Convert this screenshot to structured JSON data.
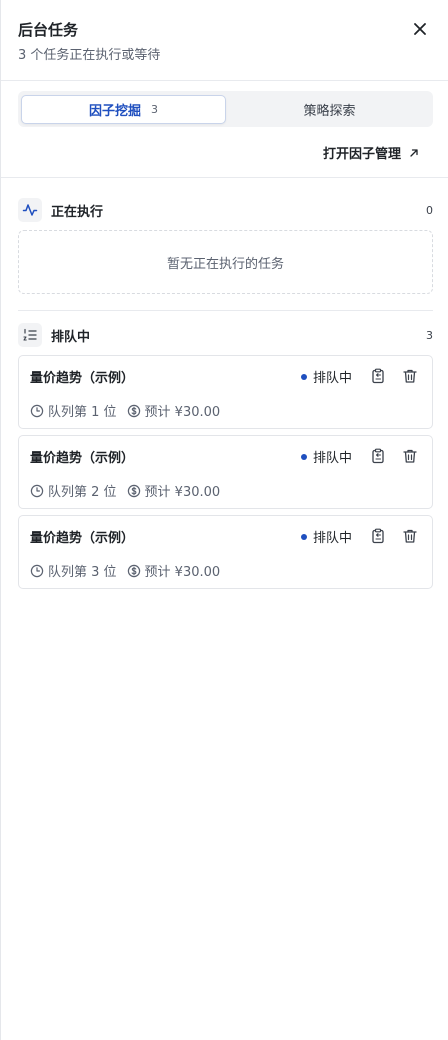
{
  "header": {
    "title": "后台任务",
    "subtitle": "3 个任务正在执行或等待",
    "close_icon": "close-icon"
  },
  "tabs": [
    {
      "label": "因子挖掘",
      "count": "3",
      "active": true
    },
    {
      "label": "策略探索",
      "count": "",
      "active": false
    }
  ],
  "open_link": {
    "label": "打开因子管理",
    "icon": "external-arrow-icon"
  },
  "running": {
    "title": "正在执行",
    "count": "0",
    "icon": "activity-icon",
    "empty_text": "暂无正在执行的任务"
  },
  "queued": {
    "title": "排队中",
    "count": "3",
    "icon": "ordered-list-icon",
    "items": [
      {
        "title": "量价趋势（示例）",
        "status": "排队中",
        "position": "队列第 1 位",
        "estimate": "预计 ¥30.00"
      },
      {
        "title": "量价趋势（示例）",
        "status": "排队中",
        "position": "队列第 2 位",
        "estimate": "预计 ¥30.00"
      },
      {
        "title": "量价趋势（示例）",
        "status": "排队中",
        "position": "队列第 3 位",
        "estimate": "预计 ¥30.00"
      }
    ]
  },
  "colors": {
    "accent": "#1f4fbf",
    "status_dot": "#1f4fbf",
    "border": "#e3e5e9",
    "muted_text": "#5b6270"
  }
}
